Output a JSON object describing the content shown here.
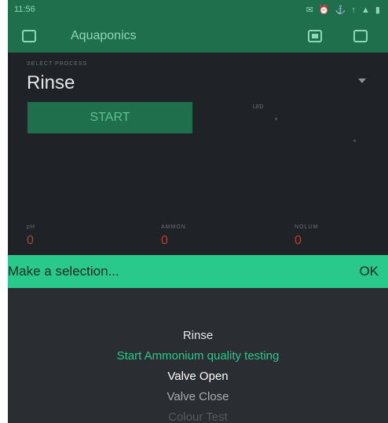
{
  "statusbar": {
    "time": "11:56",
    "icons": "✉ ⏰ ⚓ ↑ ▲ ▮",
    "color": "#1f6e4c"
  },
  "appbar": {
    "title": "Aquaponics",
    "icons": [
      "back-icon",
      "battery-icon",
      "square-icon"
    ]
  },
  "dashboard": {
    "dropdown_label": "SELECT PROCESS",
    "dropdown_value": "Rinse",
    "start_button": "START",
    "minor_label": "LED",
    "values": [
      {
        "label": "pH",
        "value": "0"
      },
      {
        "label": "AMMON",
        "value": "0"
      },
      {
        "label": "NOLUM",
        "value": "0"
      }
    ]
  },
  "banner": {
    "message": "Make a selection...",
    "ok": "OK",
    "color": "#29c98b"
  },
  "picker": {
    "options": [
      {
        "label": "Rinse",
        "color": "#e8e8e8"
      },
      {
        "label": "Start Ammonium quality testing",
        "color": "#29c98b"
      },
      {
        "label": "Valve Open",
        "color": "#ffffff"
      },
      {
        "label": "Valve Close",
        "color": "#a9adb2"
      },
      {
        "label": "Colour Test",
        "color": "#565b60"
      }
    ]
  }
}
